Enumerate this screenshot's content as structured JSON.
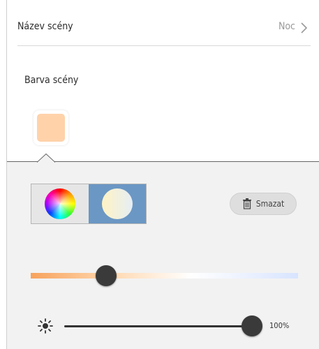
{
  "scene": {
    "name_label": "Název scény",
    "name_value": "Noc",
    "color_label": "Barva scény",
    "color_swatch": "#ffd2aa"
  },
  "color_panel": {
    "modes": [
      {
        "name": "color-wheel",
        "selected": false
      },
      {
        "name": "white-temperature",
        "selected": true
      }
    ],
    "delete_label": "Smazat",
    "temperature_level": 0.28,
    "brightness_value": "100%",
    "brightness_level": 1.0
  },
  "icons": {
    "chevron": "chevron-right-icon",
    "trash": "trash-icon",
    "brightness": "sun-icon"
  },
  "colors": {
    "selected_mode": "#6b97c4",
    "swatch": "#ffd2aa",
    "thumb": "#3a3a3a"
  }
}
